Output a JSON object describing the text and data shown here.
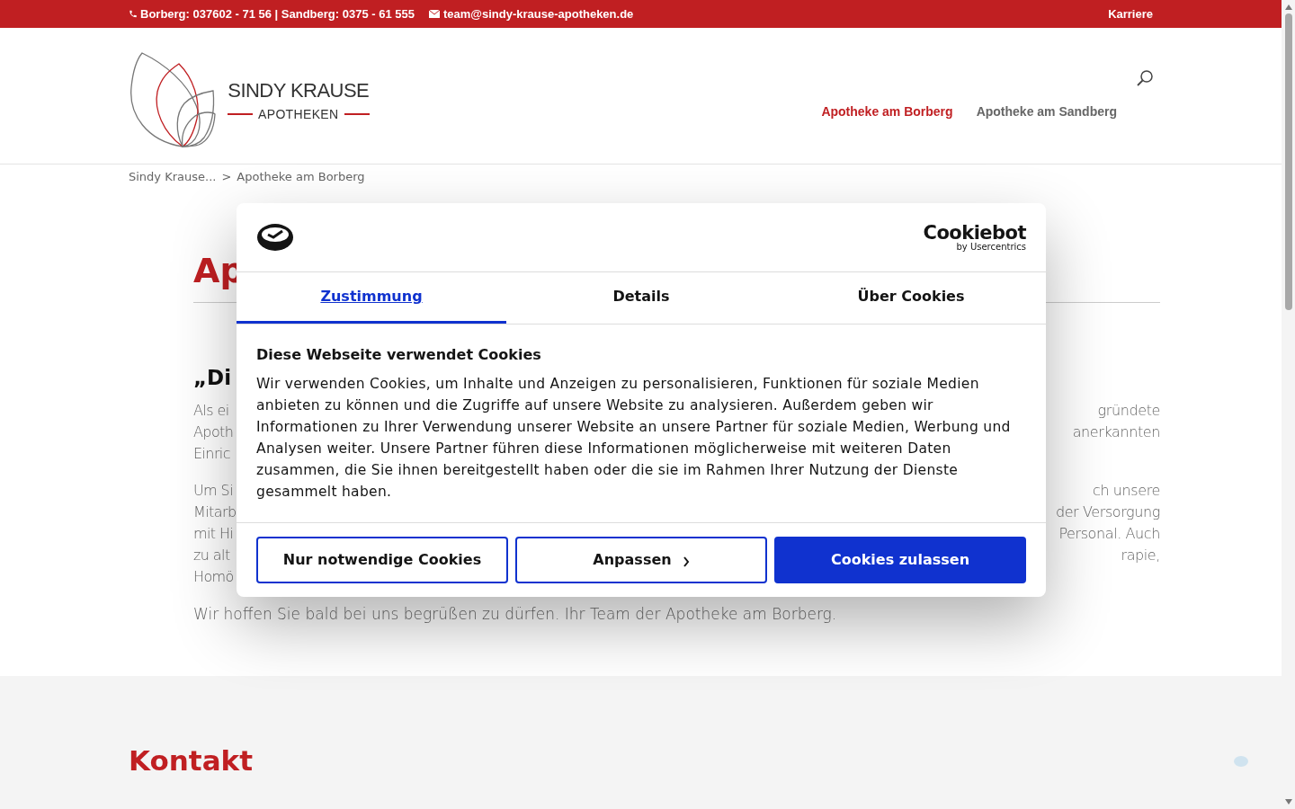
{
  "top_bar": {
    "phone": "Borberg: 037602 - 71 56 | Sandberg: 0375 - 61 555",
    "email": "team@sindy-krause-apotheken.de",
    "link": "Karriere"
  },
  "header": {
    "logo_name": "SINDY KRAUSE",
    "logo_sub": "APOTHEKEN",
    "nav": [
      {
        "label": "Apotheke am Borberg",
        "selected": true
      },
      {
        "label": "Apotheke am Sandberg",
        "selected": false
      }
    ]
  },
  "breadcrumb": {
    "parent": "Sindy Krause...",
    "separator": ">",
    "current": "Apotheke am Borberg"
  },
  "page": {
    "title": "Ap",
    "subtitle": "„Di",
    "paragraphs": [
      {
        "lines": [
          {
            "left": "Als ei",
            "right": "gründete"
          },
          {
            "left": "Apoth",
            "right": "anerkannten"
          },
          {
            "left": "Einric"
          }
        ]
      },
      {
        "lines": [
          {
            "left": "Um Si",
            "right": "ch unsere"
          },
          {
            "left": "Mitarb",
            "right": "der Versorgung"
          },
          {
            "left": "mit Hi",
            "right": "Personal. Auch"
          },
          {
            "left": "zu alt",
            "right": "rapie,"
          },
          {
            "left": "Homö"
          }
        ]
      }
    ],
    "closing": "Wir hoffen Sie bald bei uns begrüßen zu dürfen. Ihr Team der Apotheke am Borberg."
  },
  "contact": {
    "title": "Kontakt"
  },
  "cookie_dialog": {
    "brand": "Cookiebot",
    "brand_sub": "by Usercentrics",
    "tabs": [
      {
        "label": "Zustimmung",
        "selected": true
      },
      {
        "label": "Details",
        "selected": false
      },
      {
        "label": "Über Cookies",
        "selected": false
      }
    ],
    "heading": "Diese Webseite verwendet Cookies",
    "body": "Wir verwenden Cookies, um Inhalte und Anzeigen zu personalisieren, Funktionen für soziale Medien anbieten zu können und die Zugriffe auf unsere Website zu analysieren. Außerdem geben wir Informationen zu Ihrer Verwendung unserer Website an unsere Partner für soziale Medien, Werbung und Analysen weiter. Unsere Partner führen diese Informationen möglicherweise mit weiteren Daten zusammen, die Sie ihnen bereitgestellt haben oder die sie im Rahmen Ihrer Nutzung der Dienste gesammelt haben.",
    "buttons": [
      {
        "label": "Nur notwendige Cookies",
        "kind": "outline"
      },
      {
        "label": "Anpassen",
        "kind": "chevron"
      },
      {
        "label": "Cookies zulassen",
        "kind": "primary"
      }
    ]
  }
}
